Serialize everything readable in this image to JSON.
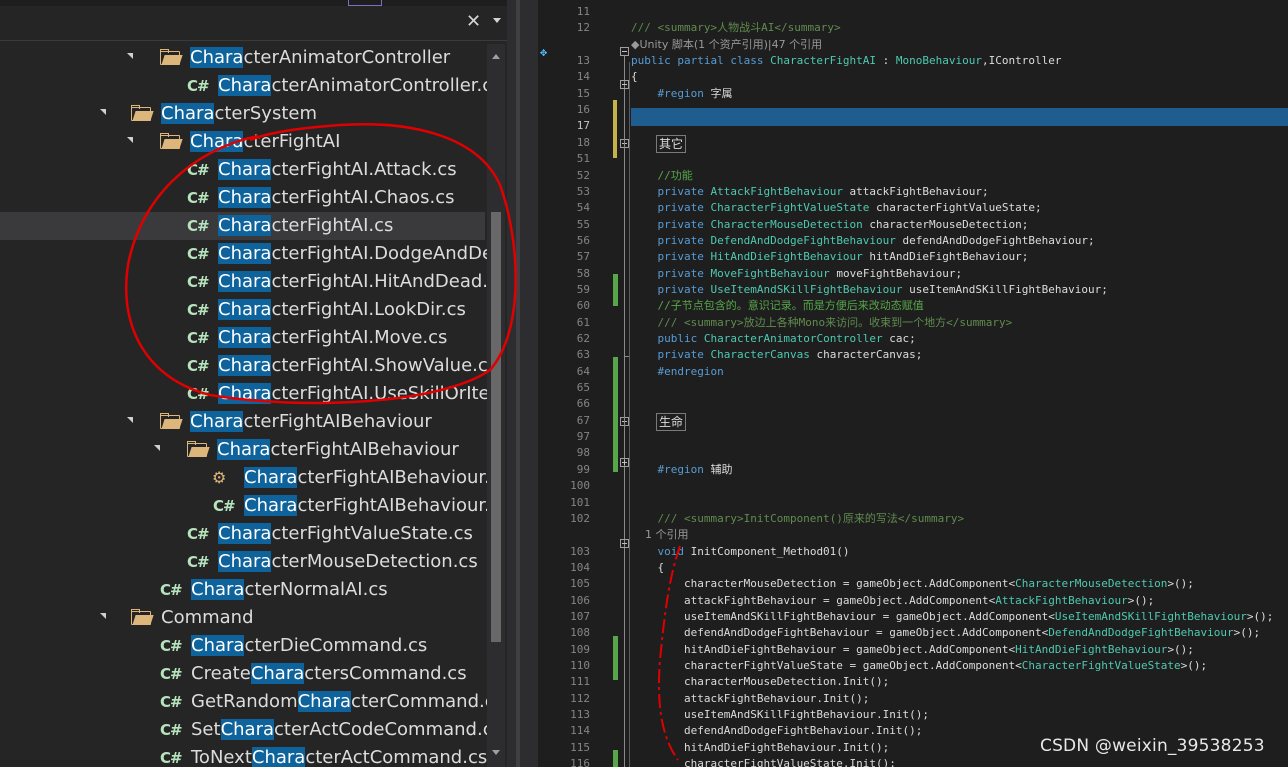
{
  "toolbar": {
    "close_glyph": "✕"
  },
  "tree": {
    "items": [
      {
        "depth": 2,
        "kind": "folder",
        "expanded": true,
        "pre": "",
        "match": "Chara",
        "post": "cterAnimatorController"
      },
      {
        "depth": 3,
        "kind": "cs",
        "pre": "",
        "match": "Chara",
        "post": "cterAnimatorController.c"
      },
      {
        "depth": 1,
        "kind": "folder",
        "expanded": true,
        "pre": "",
        "match": "Chara",
        "post": "cterSystem"
      },
      {
        "depth": 2,
        "kind": "folder",
        "expanded": true,
        "pre": "",
        "match": "Chara",
        "post": "cterFightAI"
      },
      {
        "depth": 3,
        "kind": "cs",
        "pre": "",
        "match": "Chara",
        "post": "cterFightAI.Attack.cs"
      },
      {
        "depth": 3,
        "kind": "cs",
        "pre": "",
        "match": "Chara",
        "post": "cterFightAI.Chaos.cs"
      },
      {
        "depth": 3,
        "kind": "cs",
        "selected": true,
        "pre": "",
        "match": "Chara",
        "post": "cterFightAI.cs"
      },
      {
        "depth": 3,
        "kind": "cs",
        "pre": "",
        "match": "Chara",
        "post": "cterFightAI.DodgeAndDe"
      },
      {
        "depth": 3,
        "kind": "cs",
        "pre": "",
        "match": "Chara",
        "post": "cterFightAI.HitAndDead.c"
      },
      {
        "depth": 3,
        "kind": "cs",
        "pre": "",
        "match": "Chara",
        "post": "cterFightAI.LookDir.cs"
      },
      {
        "depth": 3,
        "kind": "cs",
        "pre": "",
        "match": "Chara",
        "post": "cterFightAI.Move.cs"
      },
      {
        "depth": 3,
        "kind": "cs",
        "pre": "",
        "match": "Chara",
        "post": "cterFightAI.ShowValue.cs"
      },
      {
        "depth": 3,
        "kind": "cs",
        "pre": "",
        "match": "Chara",
        "post": "cterFightAI.UseSkillOrIter"
      },
      {
        "depth": 2,
        "kind": "folder",
        "expanded": true,
        "pre": "",
        "match": "Chara",
        "post": "cterFightAIBehaviour"
      },
      {
        "depth": 3,
        "kind": "folder",
        "expanded": true,
        "pre": "",
        "match": "Chara",
        "post": "cterFightAIBehaviour"
      },
      {
        "depth": 4,
        "kind": "unity",
        "pre": "",
        "match": "Chara",
        "post": "cterFightAIBehaviour.c"
      },
      {
        "depth": 4,
        "kind": "cs",
        "pre": "",
        "match": "Chara",
        "post": "cterFightAIBehaviour.c"
      },
      {
        "depth": 3,
        "kind": "cs",
        "pre": "",
        "match": "Chara",
        "post": "cterFightValueState.cs"
      },
      {
        "depth": 3,
        "kind": "cs",
        "pre": "",
        "match": "Chara",
        "post": "cterMouseDetection.cs"
      },
      {
        "depth": 2,
        "kind": "cs",
        "pre": "",
        "match": "Chara",
        "post": "cterNormalAI.cs"
      },
      {
        "depth": 1,
        "kind": "folder",
        "expanded": true,
        "pre": "Command",
        "match": "",
        "post": ""
      },
      {
        "depth": 2,
        "kind": "cs",
        "pre": "",
        "match": "Chara",
        "post": "cterDieCommand.cs"
      },
      {
        "depth": 2,
        "kind": "cs",
        "pre": "Create",
        "match": "Chara",
        "post": "ctersCommand.cs"
      },
      {
        "depth": 2,
        "kind": "cs",
        "pre": "GetRandom",
        "match": "Chara",
        "post": "cterCommand.cs"
      },
      {
        "depth": 2,
        "kind": "cs",
        "pre": "Set",
        "match": "Chara",
        "post": "cterActCodeCommand.cs"
      },
      {
        "depth": 2,
        "kind": "cs",
        "pre": "ToNext",
        "match": "Chara",
        "post": "cterActCommand.cs"
      }
    ]
  },
  "editor": {
    "lines": [
      {
        "n": "11",
        "segs": []
      },
      {
        "n": "12",
        "segs": [
          [
            "xd",
            "/// <summary>人物战斗AI</summary>"
          ]
        ]
      },
      {
        "hint": "◆Unity 脚本(1 个资产引用)|47 个引用"
      },
      {
        "n": "13",
        "segs": [
          [
            "kw",
            "public partial class "
          ],
          [
            "ty",
            "CharacterFightAI"
          ],
          [
            "nm",
            " : "
          ],
          [
            "ty",
            "MonoBehaviour"
          ],
          [
            "nm",
            ","
          ],
          [
            "nm",
            "IController"
          ]
        ]
      },
      {
        "n": "14",
        "segs": [
          [
            "nm",
            "{"
          ]
        ]
      },
      {
        "n": "15",
        "segs": [
          [
            "nm",
            "    "
          ],
          [
            "kw",
            "#region"
          ],
          [
            "nm",
            " 字属"
          ]
        ]
      },
      {
        "n": "16",
        "segs": []
      },
      {
        "n": "17",
        "segs": [],
        "current": true
      },
      {
        "n": "18",
        "segs": [],
        "collapsed": "其它"
      },
      {
        "n": "51",
        "segs": []
      },
      {
        "n": "52",
        "segs": [
          [
            "cm",
            "    //功能"
          ]
        ]
      },
      {
        "n": "53",
        "segs": [
          [
            "kw",
            "    private "
          ],
          [
            "ty",
            "AttackFightBehaviour"
          ],
          [
            "nm",
            " attackFightBehaviour;"
          ]
        ]
      },
      {
        "n": "54",
        "segs": [
          [
            "kw",
            "    private "
          ],
          [
            "ty",
            "CharacterFightValueState"
          ],
          [
            "nm",
            " characterFightValueState;"
          ]
        ]
      },
      {
        "n": "55",
        "segs": [
          [
            "kw",
            "    private "
          ],
          [
            "ty",
            "CharacterMouseDetection"
          ],
          [
            "nm",
            " characterMouseDetection;"
          ]
        ]
      },
      {
        "n": "56",
        "segs": [
          [
            "kw",
            "    private "
          ],
          [
            "ty",
            "DefendAndDodgeFightBehaviour"
          ],
          [
            "nm",
            " defendAndDodgeFightBehaviour;"
          ]
        ]
      },
      {
        "n": "57",
        "segs": [
          [
            "kw",
            "    private "
          ],
          [
            "ty",
            "HitAndDieFightBehaviour"
          ],
          [
            "nm",
            " hitAndDieFightBehaviour;"
          ]
        ]
      },
      {
        "n": "58",
        "segs": [
          [
            "kw",
            "    private "
          ],
          [
            "ty",
            "MoveFightBehaviour"
          ],
          [
            "nm",
            " moveFightBehaviour;"
          ]
        ]
      },
      {
        "n": "59",
        "segs": [
          [
            "kw",
            "    private "
          ],
          [
            "ty",
            "UseItemAndSKillFightBehaviour"
          ],
          [
            "nm",
            " useItemAndSKillFightBehaviour;"
          ]
        ]
      },
      {
        "n": "60",
        "segs": [
          [
            "cm",
            "    //子节点包含的。意识记录。而是方便后来改动态赋值"
          ]
        ]
      },
      {
        "n": "61",
        "segs": [
          [
            "xd",
            "    /// <summary>放边上各种Mono来访问。收束到一个地方</summary>"
          ]
        ]
      },
      {
        "n": "62",
        "segs": [
          [
            "kw",
            "    public "
          ],
          [
            "ty",
            "CharacterAnimatorController"
          ],
          [
            "nm",
            " cac;"
          ]
        ]
      },
      {
        "n": "63",
        "segs": [
          [
            "kw",
            "    private "
          ],
          [
            "ty",
            "CharacterCanvas"
          ],
          [
            "nm",
            " characterCanvas;"
          ]
        ]
      },
      {
        "n": "64",
        "segs": [
          [
            "kw",
            "    #endregion"
          ]
        ]
      },
      {
        "n": "65",
        "segs": []
      },
      {
        "n": "66",
        "segs": []
      },
      {
        "n": "67",
        "segs": [],
        "collapsed": "生命"
      },
      {
        "n": "97",
        "segs": []
      },
      {
        "n": "98",
        "segs": []
      },
      {
        "n": "99",
        "segs": [
          [
            "kw",
            "    #region"
          ],
          [
            "nm",
            " 辅助"
          ]
        ]
      },
      {
        "n": "100",
        "segs": []
      },
      {
        "n": "101",
        "segs": []
      },
      {
        "n": "102",
        "segs": [
          [
            "xd",
            "    /// <summary>InitComponent()原来的写法</summary>"
          ]
        ]
      },
      {
        "hint": "    1 个引用"
      },
      {
        "n": "103",
        "segs": [
          [
            "kw",
            "    void "
          ],
          [
            "nm",
            "InitComponent_Method01()"
          ]
        ]
      },
      {
        "n": "104",
        "segs": [
          [
            "nm",
            "    {"
          ]
        ]
      },
      {
        "n": "105",
        "segs": [
          [
            "nm",
            "        characterMouseDetection = gameObject.AddComponent<"
          ],
          [
            "ty",
            "CharacterMouseDetection"
          ],
          [
            "nm",
            ">();"
          ]
        ]
      },
      {
        "n": "106",
        "segs": [
          [
            "nm",
            "        attackFightBehaviour = gameObject.AddComponent<"
          ],
          [
            "ty",
            "AttackFightBehaviour"
          ],
          [
            "nm",
            ">();"
          ]
        ]
      },
      {
        "n": "107",
        "segs": [
          [
            "nm",
            "        useItemAndSKillFightBehaviour = gameObject.AddComponent<"
          ],
          [
            "ty",
            "UseItemAndSKillFightBehaviour"
          ],
          [
            "nm",
            ">();"
          ]
        ]
      },
      {
        "n": "108",
        "segs": [
          [
            "nm",
            "        defendAndDodgeFightBehaviour = gameObject.AddComponent<"
          ],
          [
            "ty",
            "DefendAndDodgeFightBehaviour"
          ],
          [
            "nm",
            ">();"
          ]
        ]
      },
      {
        "n": "109",
        "segs": [
          [
            "nm",
            "        hitAndDieFightBehaviour = gameObject.AddComponent<"
          ],
          [
            "ty",
            "HitAndDieFightBehaviour"
          ],
          [
            "nm",
            ">();"
          ]
        ]
      },
      {
        "n": "110",
        "segs": [
          [
            "nm",
            "        characterFightValueState = gameObject.AddComponent<"
          ],
          [
            "ty",
            "CharacterFightValueState"
          ],
          [
            "nm",
            ">();"
          ]
        ]
      },
      {
        "n": "111",
        "segs": [
          [
            "nm",
            "        characterMouseDetection.Init();"
          ]
        ]
      },
      {
        "n": "112",
        "segs": [
          [
            "nm",
            "        attackFightBehaviour.Init();"
          ]
        ]
      },
      {
        "n": "113",
        "segs": [
          [
            "nm",
            "        useItemAndSKillFightBehaviour.Init();"
          ]
        ]
      },
      {
        "n": "114",
        "segs": [
          [
            "nm",
            "        defendAndDodgeFightBehaviour.Init();"
          ]
        ]
      },
      {
        "n": "115",
        "segs": [
          [
            "nm",
            "        hitAndDieFightBehaviour.Init();"
          ]
        ]
      },
      {
        "n": "116",
        "segs": [
          [
            "nm",
            "        characterFightValueState.Init();"
          ]
        ]
      }
    ]
  },
  "watermark": "CSDN @weixin_39538253",
  "colors": {
    "accent": "#0e639c",
    "folder": "#dcb67a",
    "annotation": "#e00000",
    "change_bar": "#57a64a"
  }
}
